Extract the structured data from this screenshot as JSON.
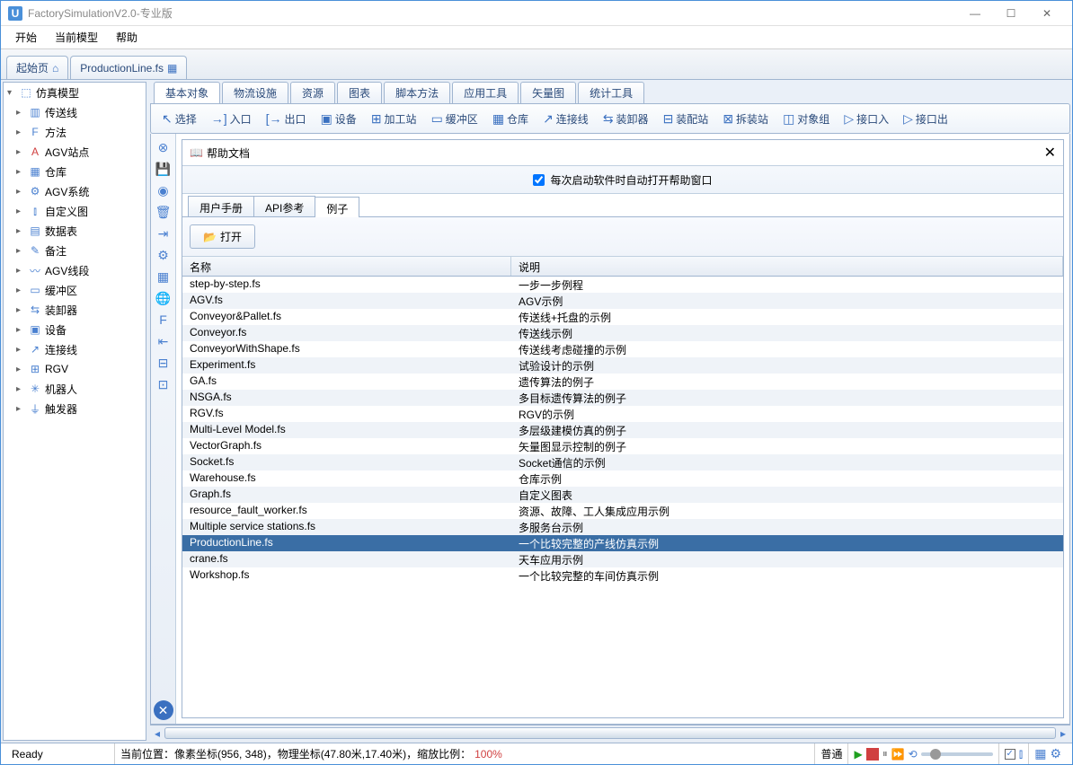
{
  "titlebar": {
    "app_letter": "U",
    "title": "FactorySimulationV2.0-专业版"
  },
  "menubar": {
    "items": [
      "开始",
      "当前模型",
      "帮助"
    ]
  },
  "doc_tabs": [
    {
      "label": "起始页",
      "icon": "⌂"
    },
    {
      "label": "ProductionLine.fs",
      "icon": "▦"
    }
  ],
  "tree": {
    "root": "仿真模型",
    "items": [
      {
        "label": "传送线",
        "icon": "▥"
      },
      {
        "label": "方法",
        "icon": "F"
      },
      {
        "label": "AGV站点",
        "icon": "A",
        "red": true
      },
      {
        "label": "仓库",
        "icon": "▦"
      },
      {
        "label": "AGV系统",
        "icon": "⚙"
      },
      {
        "label": "自定义图",
        "icon": "⫾"
      },
      {
        "label": "数据表",
        "icon": "▤"
      },
      {
        "label": "备注",
        "icon": "✎"
      },
      {
        "label": "AGV线段",
        "icon": "〰"
      },
      {
        "label": "缓冲区",
        "icon": "▭"
      },
      {
        "label": "装卸器",
        "icon": "⇆"
      },
      {
        "label": "设备",
        "icon": "▣"
      },
      {
        "label": "连接线",
        "icon": "↗"
      },
      {
        "label": "RGV",
        "icon": "⊞"
      },
      {
        "label": "机器人",
        "icon": "✳"
      },
      {
        "label": "触发器",
        "icon": "⏚"
      }
    ]
  },
  "ribbon": {
    "tabs": [
      "基本对象",
      "物流设施",
      "资源",
      "图表",
      "脚本方法",
      "应用工具",
      "矢量图",
      "统计工具"
    ],
    "buttons": [
      {
        "label": "选择",
        "icon": "↖"
      },
      {
        "label": "入口",
        "icon": "→]"
      },
      {
        "label": "出口",
        "icon": "[→"
      },
      {
        "label": "设备",
        "icon": "▣"
      },
      {
        "label": "加工站",
        "icon": "⊞"
      },
      {
        "label": "缓冲区",
        "icon": "▭"
      },
      {
        "label": "仓库",
        "icon": "▦"
      },
      {
        "label": "连接线",
        "icon": "↗"
      },
      {
        "label": "装卸器",
        "icon": "⇆"
      },
      {
        "label": "装配站",
        "icon": "⊟"
      },
      {
        "label": "拆装站",
        "icon": "⊠"
      },
      {
        "label": "对象组",
        "icon": "◫"
      },
      {
        "label": "接口入",
        "icon": "▷"
      },
      {
        "label": "接口出",
        "icon": "▷"
      }
    ]
  },
  "panel": {
    "title": "帮助文档",
    "checkbox_label": "每次启动软件时自动打开帮助窗口",
    "sub_tabs": [
      "用户手册",
      "API参考",
      "例子"
    ],
    "open_label": "打开",
    "columns": [
      "名称",
      "说明"
    ],
    "rows": [
      {
        "name": "step-by-step.fs",
        "desc": "一步一步例程"
      },
      {
        "name": "AGV.fs",
        "desc": "AGV示例"
      },
      {
        "name": "Conveyor&Pallet.fs",
        "desc": "传送线+托盘的示例"
      },
      {
        "name": "Conveyor.fs",
        "desc": "传送线示例"
      },
      {
        "name": "ConveyorWithShape.fs",
        "desc": "传送线考虑碰撞的示例"
      },
      {
        "name": "Experiment.fs",
        "desc": "试验设计的示例"
      },
      {
        "name": "GA.fs",
        "desc": "遗传算法的例子"
      },
      {
        "name": "NSGA.fs",
        "desc": "多目标遗传算法的例子"
      },
      {
        "name": "RGV.fs",
        "desc": "RGV的示例"
      },
      {
        "name": "Multi-Level Model.fs",
        "desc": "多层级建模仿真的例子"
      },
      {
        "name": "VectorGraph.fs",
        "desc": "矢量图显示控制的例子"
      },
      {
        "name": "Socket.fs",
        "desc": "Socket通信的示例"
      },
      {
        "name": "Warehouse.fs",
        "desc": "仓库示例"
      },
      {
        "name": "Graph.fs",
        "desc": "自定义图表"
      },
      {
        "name": "resource_fault_worker.fs",
        "desc": "资源、故障、工人集成应用示例"
      },
      {
        "name": "Multiple service stations.fs",
        "desc": "多服务台示例"
      },
      {
        "name": "ProductionLine.fs",
        "desc": "一个比较完整的产线仿真示例",
        "selected": true
      },
      {
        "name": "crane.fs",
        "desc": "天车应用示例"
      },
      {
        "name": "Workshop.fs",
        "desc": "一个比较完整的车间仿真示例"
      }
    ]
  },
  "status": {
    "ready": "Ready",
    "pos_label": "当前位置：像素坐标(956, 348)，物理坐标(47.80米,17.40米)，缩放比例：",
    "zoom": "100%",
    "mode": "普通"
  }
}
